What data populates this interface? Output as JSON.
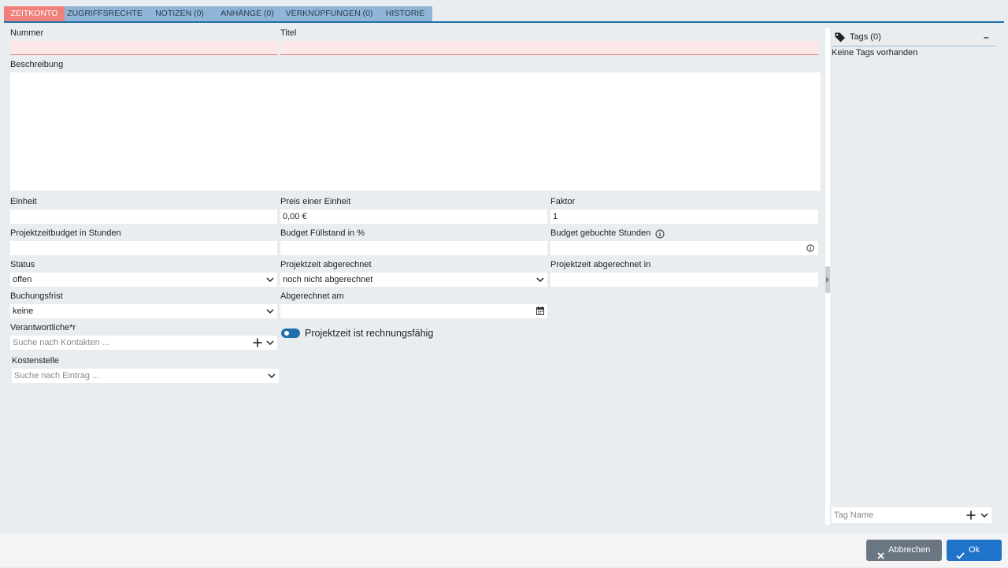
{
  "tabs": [
    {
      "label": "Zeitkonto",
      "active": true
    },
    {
      "label": "Zugriffsrechte"
    },
    {
      "label": "Notizen (0)"
    },
    {
      "label": "Anhänge (0)"
    },
    {
      "label": "Verknüpfungen (0)"
    },
    {
      "label": "Historie"
    }
  ],
  "form": {
    "nummer_label": "Nummer",
    "nummer_value": "",
    "titel_label": "Titel",
    "titel_value": "",
    "beschreibung_label": "Beschreibung",
    "beschreibung_value": "",
    "einheit_label": "Einheit",
    "einheit_value": "",
    "preis_label": "Preis einer Einheit",
    "preis_value": "0,00 €",
    "faktor_label": "Faktor",
    "faktor_value": "1",
    "budget_stunden_label": "Projektzeitbudget in Stunden",
    "budget_stunden_value": "",
    "fuellstand_label": "Budget Füllstand in %",
    "fuellstand_value": "",
    "gebuchte_label": "Budget gebuchte Stunden",
    "gebuchte_value": "",
    "status_label": "Status",
    "status_value": "offen",
    "abgerechnet_label": "Projektzeit abgerechnet",
    "abgerechnet_value": "noch nicht abgerechnet",
    "abgerechnet_in_label": "Projektzeit abgerechnet in",
    "abgerechnet_in_value": "",
    "frist_label": "Buchungsfrist",
    "frist_value": "keine",
    "abgerechnet_am_label": "Abgerechnet am",
    "abgerechnet_am_value": "",
    "verantwortlich_label": "Verantwortliche*r",
    "verantwortlich_placeholder": "Suche nach Kontakten ...",
    "kostenstelle_label": "Kostenstelle",
    "kostenstelle_placeholder": "Suche nach Eintrag ...",
    "rechnungsfaehig_label": "Projektzeit ist rechnungsfähig",
    "rechnungsfaehig_on": true
  },
  "tags": {
    "title": "Tags (0)",
    "collapse_symbol": "–",
    "empty_text": "Keine Tags vorhanden",
    "input_placeholder": "Tag Name"
  },
  "buttons": {
    "cancel": "Abbrechen",
    "ok": "Ok"
  },
  "colors": {
    "accent": "#1f6fa8",
    "tab_active": "#f0807a",
    "tab_inactive": "#8fb6d8",
    "required_bg": "#fde8e8",
    "ok_button": "#1f74c9",
    "cancel_button": "#6a7682"
  },
  "icons": {
    "tag": "tag-icon",
    "info": "info-icon",
    "calendar": "calendar-icon",
    "plus": "plus-icon",
    "chevron": "chevron-down-icon",
    "close": "close-icon",
    "check": "check-icon"
  }
}
